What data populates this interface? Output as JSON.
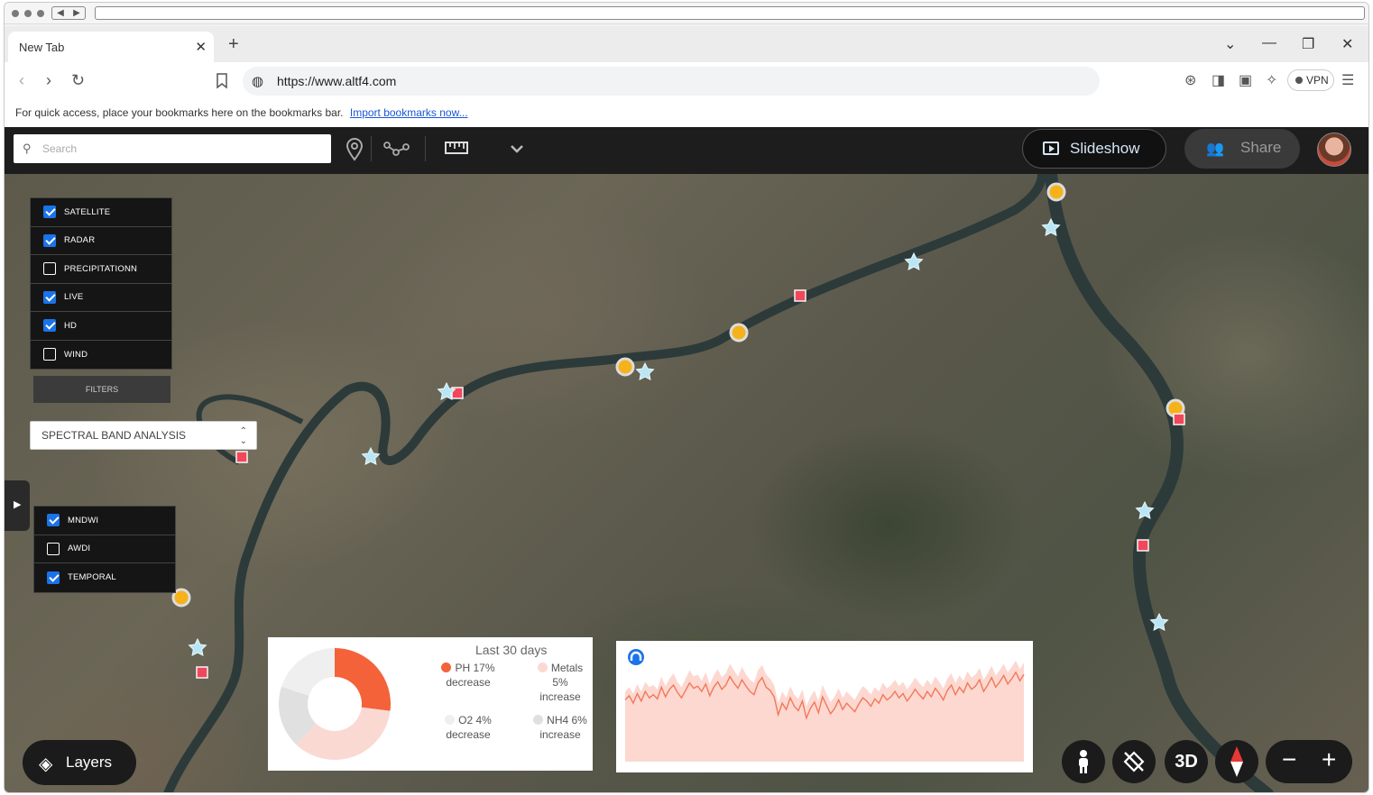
{
  "browser": {
    "tab_title": "New Tab",
    "tab_close": "✕",
    "new_tab": "+",
    "url": "https://www.altf4.com",
    "vpn_label": "VPN",
    "bookmarks_message": "For quick access, place your bookmarks here on the bookmarks bar.",
    "bookmarks_link": "Import bookmarks now..."
  },
  "app": {
    "search_placeholder": "Search",
    "slideshow_label": "Slideshow",
    "share_label": "Share",
    "layers_panel": [
      {
        "label": "SATELLITE",
        "checked": true
      },
      {
        "label": "RADAR",
        "checked": true
      },
      {
        "label": "PRECIPITATIONN",
        "checked": false
      },
      {
        "label": "LIVE",
        "checked": true
      },
      {
        "label": "HD",
        "checked": true
      },
      {
        "label": "WIND",
        "checked": false
      }
    ],
    "filters_label": "FILTERS",
    "select_value": "SPECTRAL BAND ANALYSIS",
    "band_panel": [
      {
        "label": "MNDWI",
        "checked": true
      },
      {
        "label": "AWDI",
        "checked": false
      },
      {
        "label": "TEMPORAL",
        "checked": true
      }
    ],
    "layers_button": "Layers",
    "three_d_label": "3D",
    "zoom_out": "−",
    "zoom_in": "+"
  },
  "colors": {
    "accent_blue": "#1a73e8",
    "marker_yellow": "#f5b21b",
    "marker_red": "#f0475a",
    "marker_star": "#b9e6f5",
    "river": "#2c3a3a",
    "donut_ph": "#f4623a",
    "donut_metals": "#fbd9d3",
    "donut_o2": "#efefef",
    "donut_nh4": "#e0e0e0",
    "area_fill": "#fcd8d0",
    "line": "#f2785a"
  },
  "chart_data": [
    {
      "type": "pie",
      "title": "Last 30 days",
      "donut": true,
      "slices": [
        {
          "name": "PH 17%",
          "sub": "decrease",
          "value": 0.27,
          "color": "#f4623a"
        },
        {
          "name": "Metals 5%",
          "sub": "increase",
          "value": 0.35,
          "color": "#fbd9d3"
        },
        {
          "name": "NH4 6%",
          "sub": "increase",
          "value": 0.18,
          "color": "#e0e0e0"
        },
        {
          "name": "O2 4%",
          "sub": "decrease",
          "value": 0.2,
          "color": "#efefef"
        }
      ]
    },
    {
      "type": "area",
      "series": [
        {
          "values": [
            58,
            62,
            55,
            64,
            57,
            66,
            60,
            63,
            59,
            70,
            61,
            68,
            72,
            65,
            60,
            67,
            74,
            69,
            71,
            66,
            73,
            62,
            70,
            75,
            68,
            72,
            80,
            74,
            69,
            77,
            71,
            66,
            63,
            74,
            79,
            70,
            67,
            61,
            44,
            55,
            49,
            60,
            52,
            48,
            57,
            41,
            50,
            56,
            46,
            61,
            53,
            45,
            50,
            58,
            49,
            55,
            51,
            47,
            54,
            60,
            57,
            52,
            59,
            55,
            63,
            58,
            61,
            66,
            60,
            64,
            57,
            62,
            68,
            63,
            59,
            66,
            61,
            69,
            64,
            58,
            67,
            72,
            63,
            70,
            65,
            74,
            68,
            71,
            77,
            66,
            72,
            79,
            70,
            75,
            81,
            73,
            78,
            84,
            76,
            82
          ]
        },
        {
          "values": [
            66,
            70,
            64,
            73,
            66,
            75,
            70,
            72,
            68,
            80,
            71,
            78,
            83,
            75,
            70,
            78,
            86,
            80,
            82,
            76,
            84,
            73,
            81,
            87,
            79,
            83,
            92,
            86,
            80,
            89,
            82,
            77,
            74,
            86,
            91,
            82,
            78,
            72,
            55,
            66,
            60,
            71,
            63,
            59,
            68,
            52,
            61,
            67,
            57,
            72,
            64,
            56,
            61,
            69,
            60,
            66,
            62,
            58,
            65,
            71,
            68,
            63,
            70,
            66,
            74,
            69,
            72,
            77,
            71,
            75,
            68,
            73,
            79,
            74,
            70,
            77,
            72,
            80,
            75,
            69,
            78,
            83,
            74,
            81,
            76,
            85,
            79,
            82,
            88,
            77,
            83,
            90,
            81,
            86,
            92,
            84,
            89,
            95,
            87,
            93
          ]
        }
      ],
      "ylim": [
        0,
        100
      ]
    }
  ]
}
